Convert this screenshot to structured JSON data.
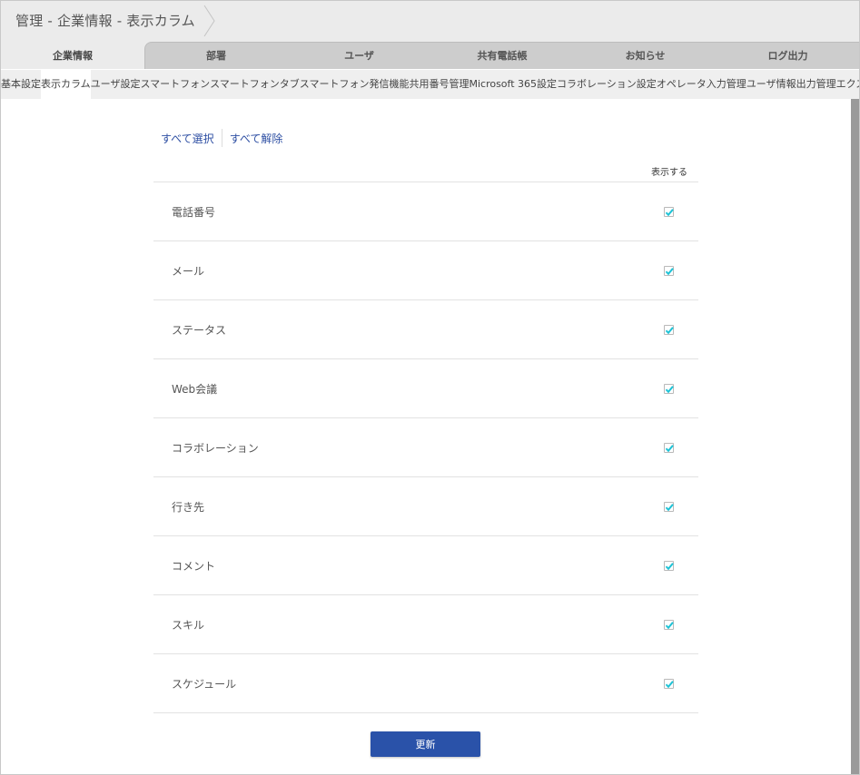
{
  "header": {
    "breadcrumb": "管理 - 企業情報 - 表示カラム"
  },
  "main_tabs": [
    {
      "label": "企業情報",
      "active": true
    },
    {
      "label": "部署",
      "active": false
    },
    {
      "label": "ユーザ",
      "active": false
    },
    {
      "label": "共有電話帳",
      "active": false
    },
    {
      "label": "お知らせ",
      "active": false
    },
    {
      "label": "ログ出力",
      "active": false
    }
  ],
  "sub_tabs": [
    {
      "label": "基本設定",
      "active": false
    },
    {
      "label": "表示カラム",
      "active": true
    },
    {
      "label": "ユーザ設定",
      "active": false
    },
    {
      "label": "スマートフォン",
      "active": false
    },
    {
      "label": "スマートフォンタブ",
      "active": false
    },
    {
      "label": "スマートフォン発信機能",
      "active": false
    },
    {
      "label": "共用番号管理",
      "active": false
    },
    {
      "label": "Microsoft 365設定",
      "active": false
    },
    {
      "label": "コラボレーション設定",
      "active": false
    },
    {
      "label": "オペレータ入力管理",
      "active": false
    },
    {
      "label": "ユーザ情報出力管理",
      "active": false
    },
    {
      "label": "エクス",
      "active": false
    }
  ],
  "bulk": {
    "select_all": "すべて選択",
    "deselect_all": "すべて解除"
  },
  "table": {
    "column_header": "表示する",
    "rows": [
      {
        "label": "電話番号",
        "checked": true
      },
      {
        "label": "メール",
        "checked": true
      },
      {
        "label": "ステータス",
        "checked": true
      },
      {
        "label": "Web会議",
        "checked": true
      },
      {
        "label": "コラボレーション",
        "checked": true
      },
      {
        "label": "行き先",
        "checked": true
      },
      {
        "label": "コメント",
        "checked": true
      },
      {
        "label": "スキル",
        "checked": true
      },
      {
        "label": "スケジュール",
        "checked": true
      }
    ]
  },
  "actions": {
    "update_label": "更新"
  },
  "colors": {
    "accent": "#2a52a9",
    "link": "#2e4fa3",
    "check": "#1ec3d6"
  }
}
